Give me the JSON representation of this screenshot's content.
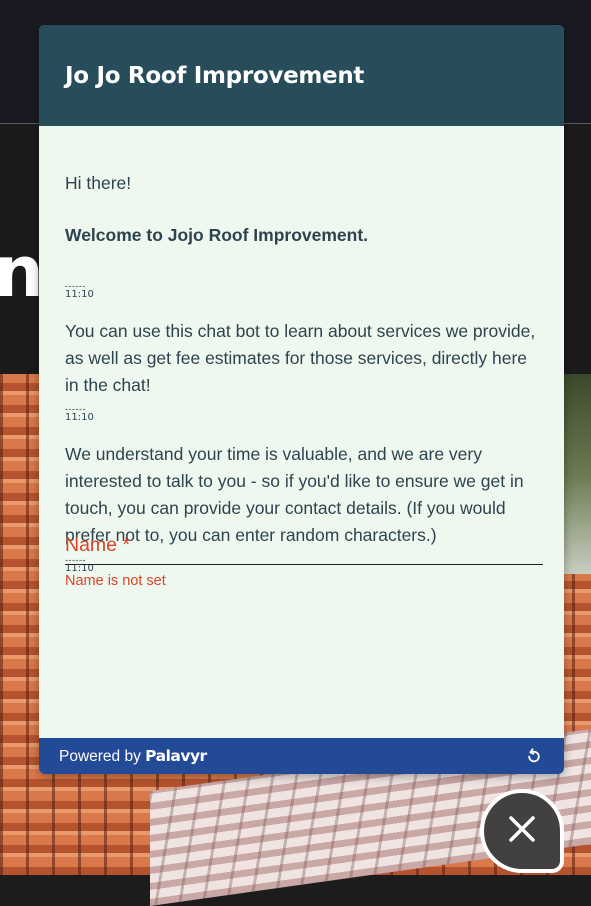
{
  "background": {
    "hero_text_fragment": "nt"
  },
  "chat": {
    "title": "Jo Jo Roof Improvement",
    "messages": [
      {
        "text": "Hi there!"
      },
      {
        "text": "Welcome to Jojo Roof Improvement.",
        "bold": true
      },
      {
        "text": "You can use this chat bot to learn about services we provide, as well as get fee estimates for those services, directly here in the chat!"
      },
      {
        "text": "We understand your time is valuable, and we are very interested to talk to you - so if you'd like to ensure we get in touch, you can provide your contact details. (If you would prefer not to, you can enter random characters.)"
      }
    ],
    "timestamps": [
      "11:10",
      "11:10",
      "11:10"
    ],
    "name_field": {
      "label": "Name *",
      "value": "",
      "error": "Name is not set"
    },
    "footer": {
      "powered_by": "Powered by",
      "brand": "Palavyr"
    }
  },
  "colors": {
    "header": "#274c5a",
    "body": "#eff8ee",
    "footer": "#234a96",
    "error": "#d9442a"
  },
  "icons": {
    "restart": "restart-icon",
    "close": "close-icon"
  }
}
